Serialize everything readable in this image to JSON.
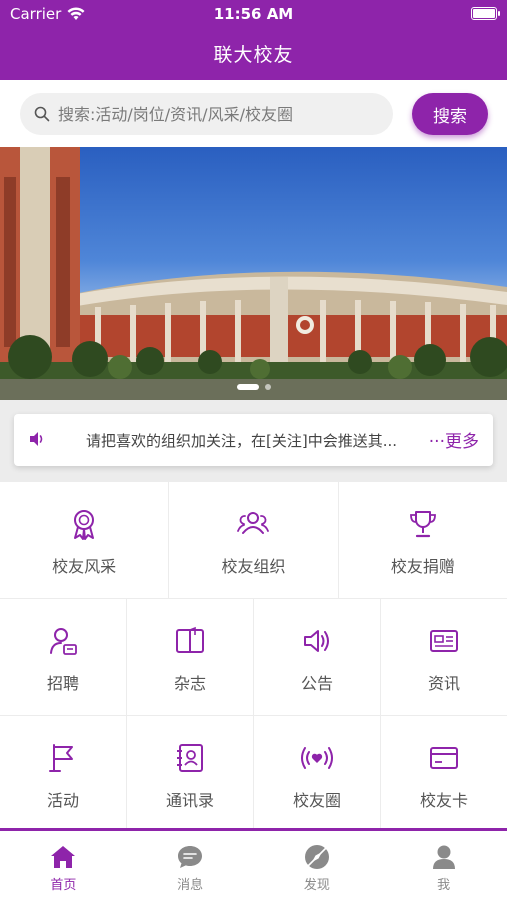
{
  "status_bar": {
    "carrier": "Carrier",
    "time": "11:56 AM"
  },
  "header": {
    "title": "联大校友"
  },
  "search": {
    "placeholder": "搜索:活动/岗位/资讯/风采/校友圈",
    "button": "搜索"
  },
  "notice": {
    "text": "请把喜欢的组织加关注，在[关注]中会推送其...",
    "more": "···更多"
  },
  "grid": {
    "row1": [
      {
        "label": "校友风采",
        "icon": "medal-icon"
      },
      {
        "label": "校友组织",
        "icon": "group-icon"
      },
      {
        "label": "校友捐赠",
        "icon": "trophy-icon"
      }
    ],
    "row2": [
      {
        "label": "招聘",
        "icon": "recruit-icon"
      },
      {
        "label": "杂志",
        "icon": "book-icon"
      },
      {
        "label": "公告",
        "icon": "speaker-icon"
      },
      {
        "label": "资讯",
        "icon": "news-icon"
      }
    ],
    "row3": [
      {
        "label": "活动",
        "icon": "flag-icon"
      },
      {
        "label": "通讯录",
        "icon": "contacts-icon"
      },
      {
        "label": "校友圈",
        "icon": "broadcast-heart-icon"
      },
      {
        "label": "校友卡",
        "icon": "card-icon"
      }
    ]
  },
  "tabbar": [
    {
      "label": "首页",
      "icon": "home-icon",
      "active": true
    },
    {
      "label": "消息",
      "icon": "chat-icon",
      "active": false
    },
    {
      "label": "发现",
      "icon": "discover-icon",
      "active": false
    },
    {
      "label": "我",
      "icon": "user-icon",
      "active": false
    }
  ],
  "colors": {
    "accent": "#8e24aa",
    "text": "#555555",
    "inactive": "#8a8a8a"
  }
}
